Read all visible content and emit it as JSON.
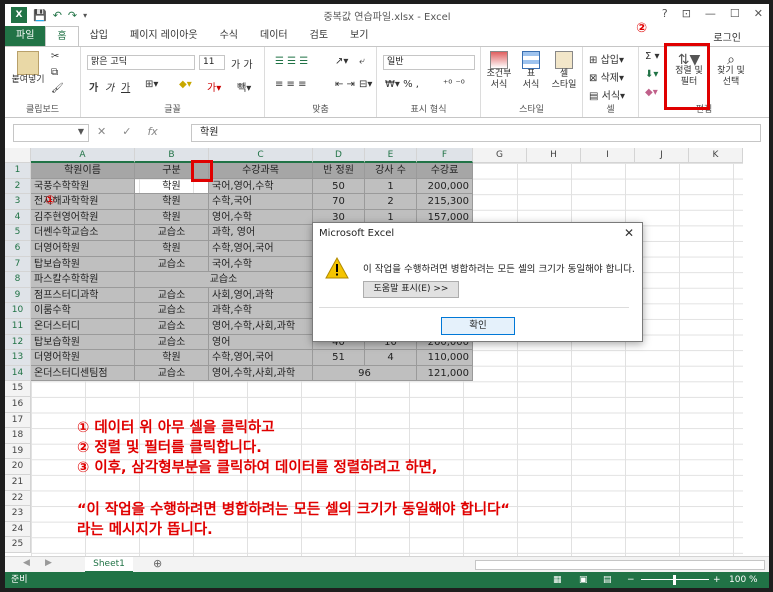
{
  "window": {
    "title": "중복값 연습파일.xlsx - Excel",
    "login": "로그인",
    "controls": [
      "?",
      "⊡",
      "—",
      "☐",
      "✕"
    ]
  },
  "qat": {
    "save_icon": "save-icon",
    "undo_icon": "undo-icon",
    "redo_icon": "redo-icon"
  },
  "tabs": [
    "파일",
    "홈",
    "삽입",
    "페이지 레이아웃",
    "수식",
    "데이터",
    "검토",
    "보기"
  ],
  "ribbon": {
    "clipboard": {
      "paste": "붙여넣기",
      "label": "클립보드"
    },
    "font": {
      "name": "맑은 고딕",
      "size": "11",
      "bold": "가",
      "italic": "가",
      "underline": "가",
      "label": "글꼴"
    },
    "align": {
      "label": "맞춤"
    },
    "number": {
      "format": "일반",
      "label": "표시 형식"
    },
    "style": {
      "conditional": "조건부\n서식",
      "table": "표\n서식",
      "cell": "셀\n스타일",
      "label": "스타일"
    },
    "cells": {
      "insert": "삽입",
      "delete": "삭제",
      "format": "서식",
      "label": "셀"
    },
    "edit": {
      "sort_filter": "정렬 및\n필터",
      "find": "찾기 및\n선택",
      "label": "편집"
    }
  },
  "formula_bar": {
    "value": "학원"
  },
  "columns": [
    "A",
    "B",
    "C",
    "D",
    "E",
    "F",
    "G",
    "H",
    "I",
    "J",
    "K"
  ],
  "rows": [
    "1",
    "2",
    "3",
    "4",
    "5",
    "6",
    "7",
    "8",
    "9",
    "10",
    "11",
    "12",
    "13",
    "14",
    "15",
    "16",
    "17",
    "18",
    "19",
    "20",
    "21",
    "22",
    "23",
    "24",
    "25"
  ],
  "table": {
    "headers": [
      "학원이름",
      "구분",
      "수강과목",
      "반 정원",
      "강사 수",
      "수강료"
    ],
    "rows": [
      [
        "국풍수학학원",
        "학원",
        "국어,영어,수학",
        "50",
        "1",
        "200,000"
      ],
      [
        "전자해과학학원",
        "학원",
        "수학,국어",
        "70",
        "2",
        "215,300"
      ],
      [
        "김주현영어학원",
        "학원",
        "영어,수학",
        "30",
        "1",
        "157,000"
      ],
      [
        "더쎈수학교습소",
        "교습소",
        "과학, 영어",
        "",
        "",
        ""
      ],
      [
        "더영어학원",
        "학원",
        "수학,영어,국어",
        "",
        "",
        ""
      ],
      [
        "탑보습학원",
        "교습소",
        "국어,수학",
        "",
        "",
        ""
      ],
      [
        "파스칼수학학원",
        "",
        "교습소",
        "",
        "",
        ""
      ],
      [
        "점프스터디과학",
        "교습소",
        "사회,영어,과학",
        "",
        "",
        ""
      ],
      [
        "이룸수학",
        "교습소",
        "과학,수학",
        "",
        "",
        ""
      ],
      [
        "온더스터디",
        "교습소",
        "영어,수학,사회,과학",
        "",
        "",
        ""
      ],
      [
        "탑보습학원",
        "교습소",
        "영어",
        "40",
        "10",
        "260,000"
      ],
      [
        "더영어학원",
        "학원",
        "수학,영어,국어",
        "51",
        "4",
        "110,000"
      ],
      [
        "온더스터디센팀점",
        "교습소",
        "영어,수학,사회,과학",
        "96",
        "",
        "121,000"
      ]
    ]
  },
  "dialog": {
    "title": "Microsoft Excel",
    "message": "이 작업을 수행하려면 병합하려는 모든 셀의 크기가 동일해야 합니다.",
    "help_button": "도움말 표시(E) >>",
    "ok_button": "확인",
    "icon": "warning-icon"
  },
  "annotations": {
    "marker_2": "②",
    "marker_3": "③",
    "marker_1": "①",
    "line1": "① 데이터 위 아무 셀을 클릭하고",
    "line2": "② 정렬 및 필터를 클릭합니다.",
    "line3": "③ 이후, 삼각형부분을 클릭하여 데이터를 정렬하려고 하면,",
    "line4": "“이 작업을 수행하려면 병합하려는 모든 셀의 크기가 동일해야 합니다“",
    "line5": "라는 메시지가 뜹니다."
  },
  "sheets": [
    "Sheet1"
  ],
  "status": {
    "mode": "준비",
    "zoom": "100 %"
  },
  "colors": {
    "excel_green": "#217346",
    "annotation_red": "#e00000"
  }
}
